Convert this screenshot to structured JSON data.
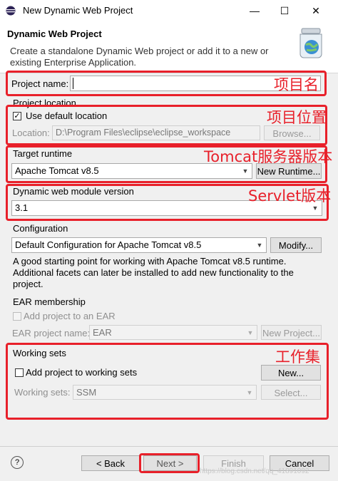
{
  "window": {
    "title": "New Dynamic Web Project",
    "minimize": "—",
    "maximize": "☐",
    "close": "✕"
  },
  "header": {
    "title": "Dynamic Web Project",
    "description": "Create a standalone Dynamic Web project or add it to a new or existing Enterprise Application."
  },
  "project_name": {
    "label": "Project name:",
    "value": ""
  },
  "project_location": {
    "group_label": "Project location",
    "use_default_label": "Use default location",
    "use_default_checked": "✓",
    "location_label": "Location:",
    "location_value": "D:\\Program Files\\eclipse\\eclipse_workspace",
    "browse_label": "Browse..."
  },
  "target_runtime": {
    "label": "Target runtime",
    "value": "Apache Tomcat v8.5",
    "new_runtime_label": "New Runtime..."
  },
  "module_version": {
    "label": "Dynamic web module version",
    "value": "3.1"
  },
  "configuration": {
    "label": "Configuration",
    "value": "Default Configuration for Apache Tomcat v8.5",
    "modify_label": "Modify...",
    "help_text": "A good starting point for working with Apache Tomcat v8.5 runtime. Additional facets can later be installed to add new functionality to the project."
  },
  "ear": {
    "label": "EAR membership",
    "add_label": "Add project to an EAR",
    "project_name_label": "EAR project name:",
    "project_name_value": "EAR",
    "new_project_label": "New Project..."
  },
  "working_sets": {
    "label": "Working sets",
    "add_label": "Add project to working sets",
    "new_label": "New...",
    "sets_label": "Working sets:",
    "sets_value": "SSM",
    "select_label": "Select..."
  },
  "annotations": {
    "project_name": "项目名",
    "project_location": "项目位置",
    "target_runtime": "Tomcat服务器版本",
    "module_version": "Servlet版本",
    "working_sets": "工作集"
  },
  "footer": {
    "help": "?",
    "back_label": "< Back",
    "next_label": "Next >",
    "finish_label": "Finish",
    "cancel_label": "Cancel",
    "watermark": "https://blog.csdn.net/qq_41891092"
  },
  "colors": {
    "annotation_red": "#e8202a",
    "dialog_bg": "#f0f0f0"
  }
}
